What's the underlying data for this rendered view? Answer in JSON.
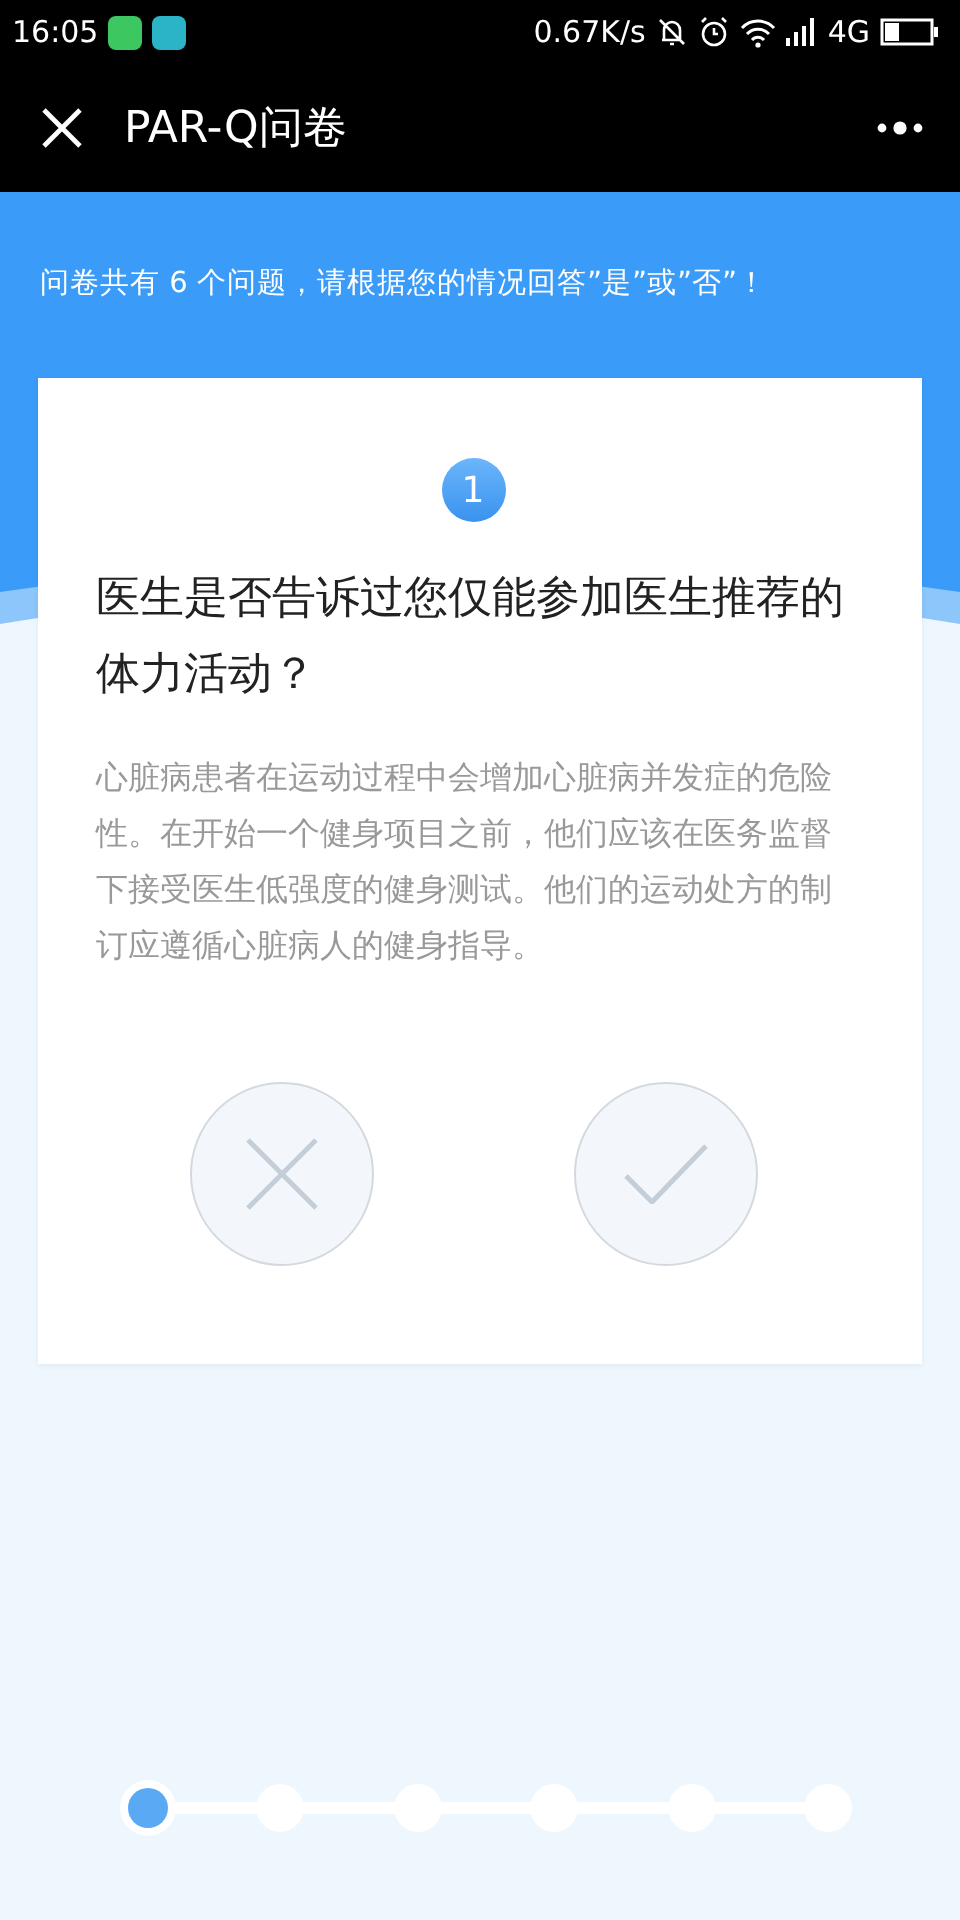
{
  "status_bar": {
    "time": "16:05",
    "speed": "0.67K/s",
    "network": "4G"
  },
  "header": {
    "title": "PAR-Q问卷"
  },
  "intro": "问卷共有 6 个问题，请根据您的情况回答”是”或”否”！",
  "question": {
    "number": "1",
    "title": "医生是否告诉过您仅能参加医生推荐的体力活动？",
    "explanation": "心脏病患者在运动过程中会增加心脏病并发症的危险性。在开始一个健身项目之前，他们应该在医务监督下接受医生低强度的健身测试。他们的运动处方的制订应遵循心脏病人的健身指导。"
  },
  "answers": [
    {
      "kind": "no"
    },
    {
      "kind": "yes"
    }
  ],
  "progress": [
    {
      "selected": true
    },
    {
      "selected": false
    },
    {
      "selected": false
    },
    {
      "selected": false
    },
    {
      "selected": false
    },
    {
      "selected": false
    }
  ]
}
